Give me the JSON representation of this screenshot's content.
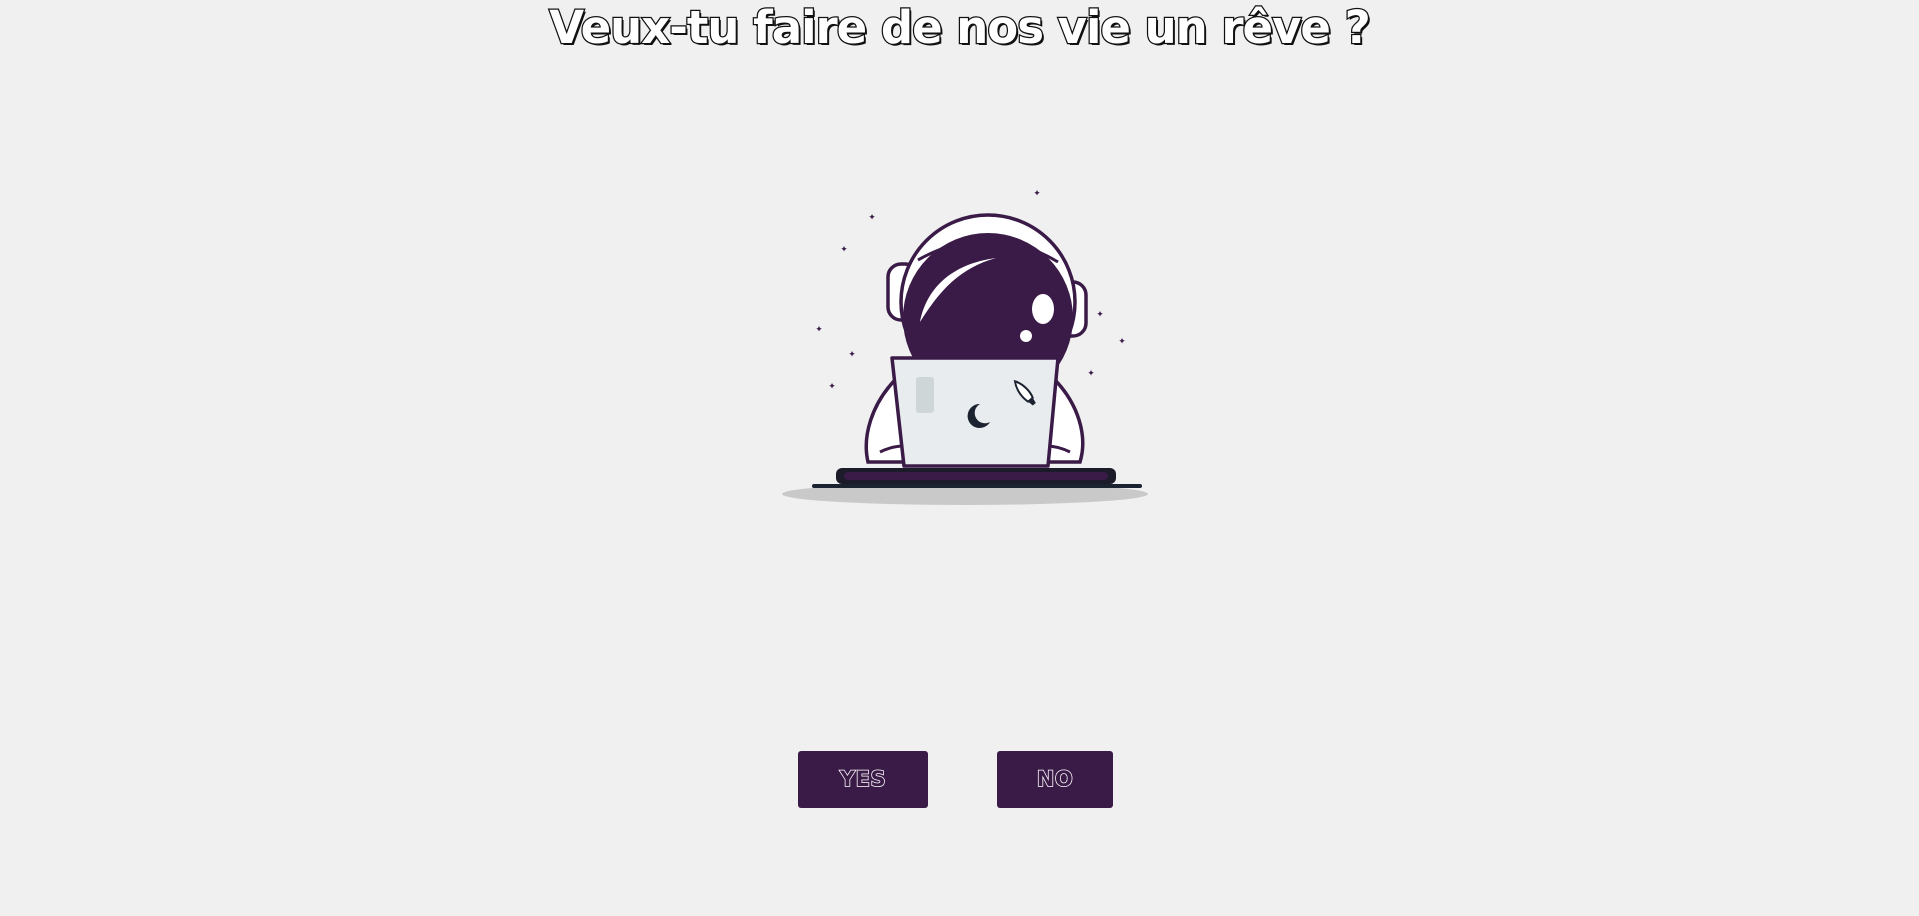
{
  "page": {
    "title": "Veux-tu faire de nos vie un rêve ?"
  },
  "illustration": {
    "subject": "astronaut-with-laptop",
    "icons": [
      "astronaut-icon",
      "laptop-icon",
      "moon-icon",
      "rocket-icon",
      "star-icon"
    ]
  },
  "buttons": {
    "yes_label": "YES",
    "no_label": "NO"
  },
  "colors": {
    "background": "#f0f0f0",
    "accent": "#3a1b47",
    "laptop": "#e8ecee"
  }
}
